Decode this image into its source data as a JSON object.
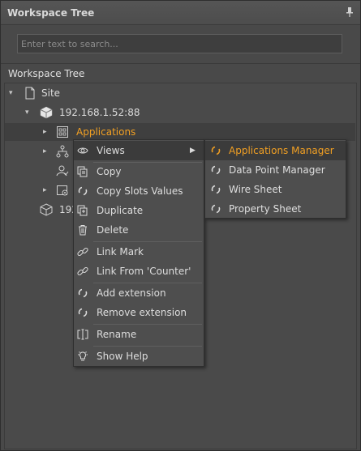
{
  "panel": {
    "title": "Workspace Tree"
  },
  "search": {
    "placeholder": "Enter text to search..."
  },
  "tree": {
    "header": "Workspace Tree",
    "nodes": [
      {
        "label": "Site"
      },
      {
        "label": "192.168.1.52:88"
      },
      {
        "label": "Applications"
      },
      {
        "label": ""
      },
      {
        "label": ""
      },
      {
        "label": ""
      },
      {
        "label": "192"
      }
    ]
  },
  "context_menu": {
    "items": [
      {
        "label": "Views",
        "icon": "eye-icon"
      },
      {
        "label": "Copy",
        "icon": "copy-icon"
      },
      {
        "label": "Copy Slots Values",
        "icon": "loading-icon"
      },
      {
        "label": "Duplicate",
        "icon": "duplicate-icon"
      },
      {
        "label": "Delete",
        "icon": "trash-icon"
      },
      {
        "label": "Link Mark",
        "icon": "link-icon"
      },
      {
        "label": "Link From 'Counter'",
        "icon": "link-icon"
      },
      {
        "label": "Add extension",
        "icon": "loading-icon"
      },
      {
        "label": "Remove extension",
        "icon": "loading-icon"
      },
      {
        "label": "Rename",
        "icon": "rename-icon"
      },
      {
        "label": "Show Help",
        "icon": "lightbulb-icon"
      }
    ]
  },
  "submenu": {
    "items": [
      {
        "label": "Applications Manager"
      },
      {
        "label": "Data Point Manager"
      },
      {
        "label": "Wire Sheet"
      },
      {
        "label": "Property Sheet"
      }
    ]
  },
  "colors": {
    "accent": "#f2a023",
    "background": "#494949",
    "menu": "#4e4e4e"
  }
}
